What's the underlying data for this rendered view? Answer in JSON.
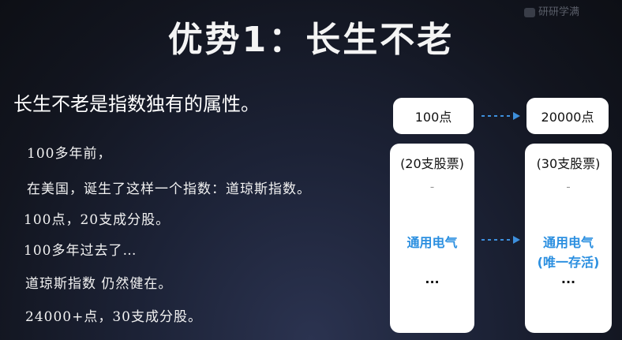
{
  "watermark": "研研学满",
  "title": "优势1：长生不老",
  "subtitle": "长生不老是指数独有的属性。",
  "body_lines": [
    "100多年前，",
    "在美国，诞生了这样一个指数：道琼斯指数。",
    "100点，20支成分股。",
    "100多年过去了…",
    "道琼斯指数 仍然健在。",
    "24000+点，30支成分股。"
  ],
  "diagram": {
    "left_top": "100点",
    "right_top": "20000点",
    "left_col": {
      "header": "(20支股票)",
      "dash": "–",
      "company": "通用电气",
      "dots": "..."
    },
    "right_col": {
      "header": "(30支股票)",
      "dash": "–",
      "company": "通用电气",
      "note": "(唯一存活)",
      "dots": "..."
    },
    "arrow_color": "#3d8fdc",
    "accent_color": "#2b8fe0"
  }
}
